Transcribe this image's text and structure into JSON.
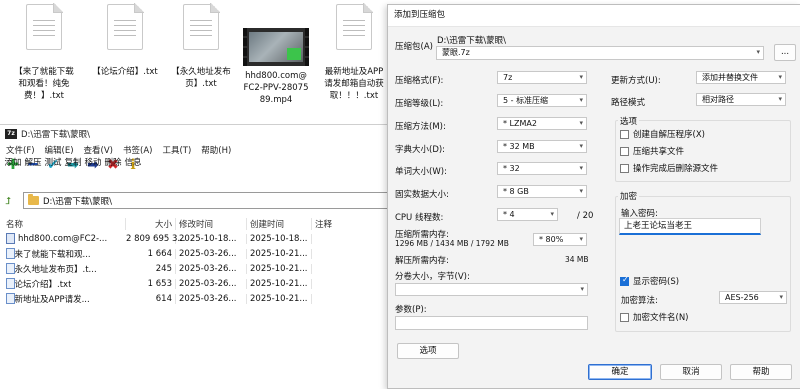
{
  "desktop": {
    "items": [
      {
        "label": "【来了就能下载和观看！纯免费！】.txt",
        "kind": "txt"
      },
      {
        "label": "【论坛介绍】.txt",
        "kind": "txt"
      },
      {
        "label": "【永久地址发布页】.txt",
        "kind": "txt"
      },
      {
        "label": "hhd800.com@FC2-PPV-2807589.mp4",
        "kind": "mp4"
      },
      {
        "label": "最新地址及APP请发邮箱自动获取！！！.txt",
        "kind": "txt"
      }
    ]
  },
  "file_manager": {
    "title": "D:\\迅雷下载\\蒙眼\\",
    "menu": [
      "文件(F)",
      "编辑(E)",
      "查看(V)",
      "书签(A)",
      "工具(T)",
      "帮助(H)"
    ],
    "toolbar": [
      {
        "label": "添加",
        "icon": "plus-icon",
        "glyph": "✚",
        "color": "#2aa63a"
      },
      {
        "label": "解压",
        "icon": "minus-icon",
        "glyph": "━",
        "color": "#1f4fb8"
      },
      {
        "label": "测试",
        "icon": "check-icon",
        "glyph": "✔",
        "color": "#1da6c8"
      },
      {
        "label": "复制",
        "icon": "copy-arrow-icon",
        "glyph": "➡",
        "color": "#1d9aa5"
      },
      {
        "label": "移动",
        "icon": "move-arrow-icon",
        "glyph": "➡",
        "color": "#1f3b8f"
      },
      {
        "label": "删除",
        "icon": "delete-icon",
        "glyph": "✖",
        "color": "#d0262a"
      },
      {
        "label": "信息",
        "icon": "info-icon",
        "glyph": "ℹ",
        "color": "#c79d10"
      }
    ],
    "path": "D:\\迅雷下载\\蒙眼\\",
    "columns": [
      "名称",
      "大小",
      "修改时间",
      "创建时间",
      "注释"
    ],
    "rows": [
      {
        "name": "hhd800.com@FC2-...",
        "size": "2 809 695 3...",
        "modified": "2025-10-18...",
        "created": "2025-10-18...",
        "type": "mp4"
      },
      {
        "name": "【来了就能下载和观...",
        "size": "1 664",
        "modified": "2025-03-26...",
        "created": "2025-10-21...",
        "type": "txt"
      },
      {
        "name": "【永久地址发布页】.t...",
        "size": "245",
        "modified": "2025-03-26...",
        "created": "2025-10-21...",
        "type": "txt"
      },
      {
        "name": "【论坛介绍】.txt",
        "size": "1 653",
        "modified": "2025-03-26...",
        "created": "2025-10-21...",
        "type": "txt"
      },
      {
        "name": "最新地址及APP请发...",
        "size": "614",
        "modified": "2025-03-26...",
        "created": "2025-10-21...",
        "type": "txt"
      }
    ]
  },
  "dialog": {
    "title": "添加到压缩包",
    "archive_label": "压缩包(A)",
    "archive_dir": "D:\\迅雷下载\\蒙眼\\",
    "archive_name": "蒙眼.7z",
    "browse_label": "...",
    "format_label": "压缩格式(F):",
    "format_value": "7z",
    "level_label": "压缩等级(L):",
    "level_value": "5 - 标准压缩",
    "method_label": "压缩方法(M):",
    "method_value": "* LZMA2",
    "dict_label": "字典大小(D):",
    "dict_value": "* 32 MB",
    "word_label": "单词大小(W):",
    "word_value": "* 32",
    "solid_label": "固实数据大小:",
    "solid_value": "* 8 GB",
    "threads_label": "CPU 线程数:",
    "threads_value": "* 4",
    "threads_total": "/ 20",
    "mem_comp_label": "压缩所需内存:",
    "mem_comp_detail": "1296 MB / 1434 MB / 1792 MB",
    "mem_comp_value": "* 80%",
    "mem_decomp_label": "解压所需内存:",
    "mem_decomp_value": "34 MB",
    "split_label": "分卷大小，字节(V):",
    "split_value": "",
    "params_label": "参数(P):",
    "params_value": "",
    "options_button": "选项",
    "update_label": "更新方式(U):",
    "update_value": "添加并替换文件",
    "pathmode_label": "路径模式",
    "pathmode_value": "相对路径",
    "options_group": "选项",
    "opt_sfx": "创建自解压程序(X)",
    "opt_shared": "压缩共享文件",
    "opt_delete": "操作完成后删除源文件",
    "encryption_group": "加密",
    "password_label": "输入密码:",
    "password_value": "上老王论坛当老王",
    "show_password": "显示密码(S)",
    "enc_method_label": "加密算法:",
    "enc_method_value": "AES-256",
    "encrypt_names": "加密文件名(N)",
    "ok": "确定",
    "cancel": "取消",
    "help": "帮助"
  }
}
